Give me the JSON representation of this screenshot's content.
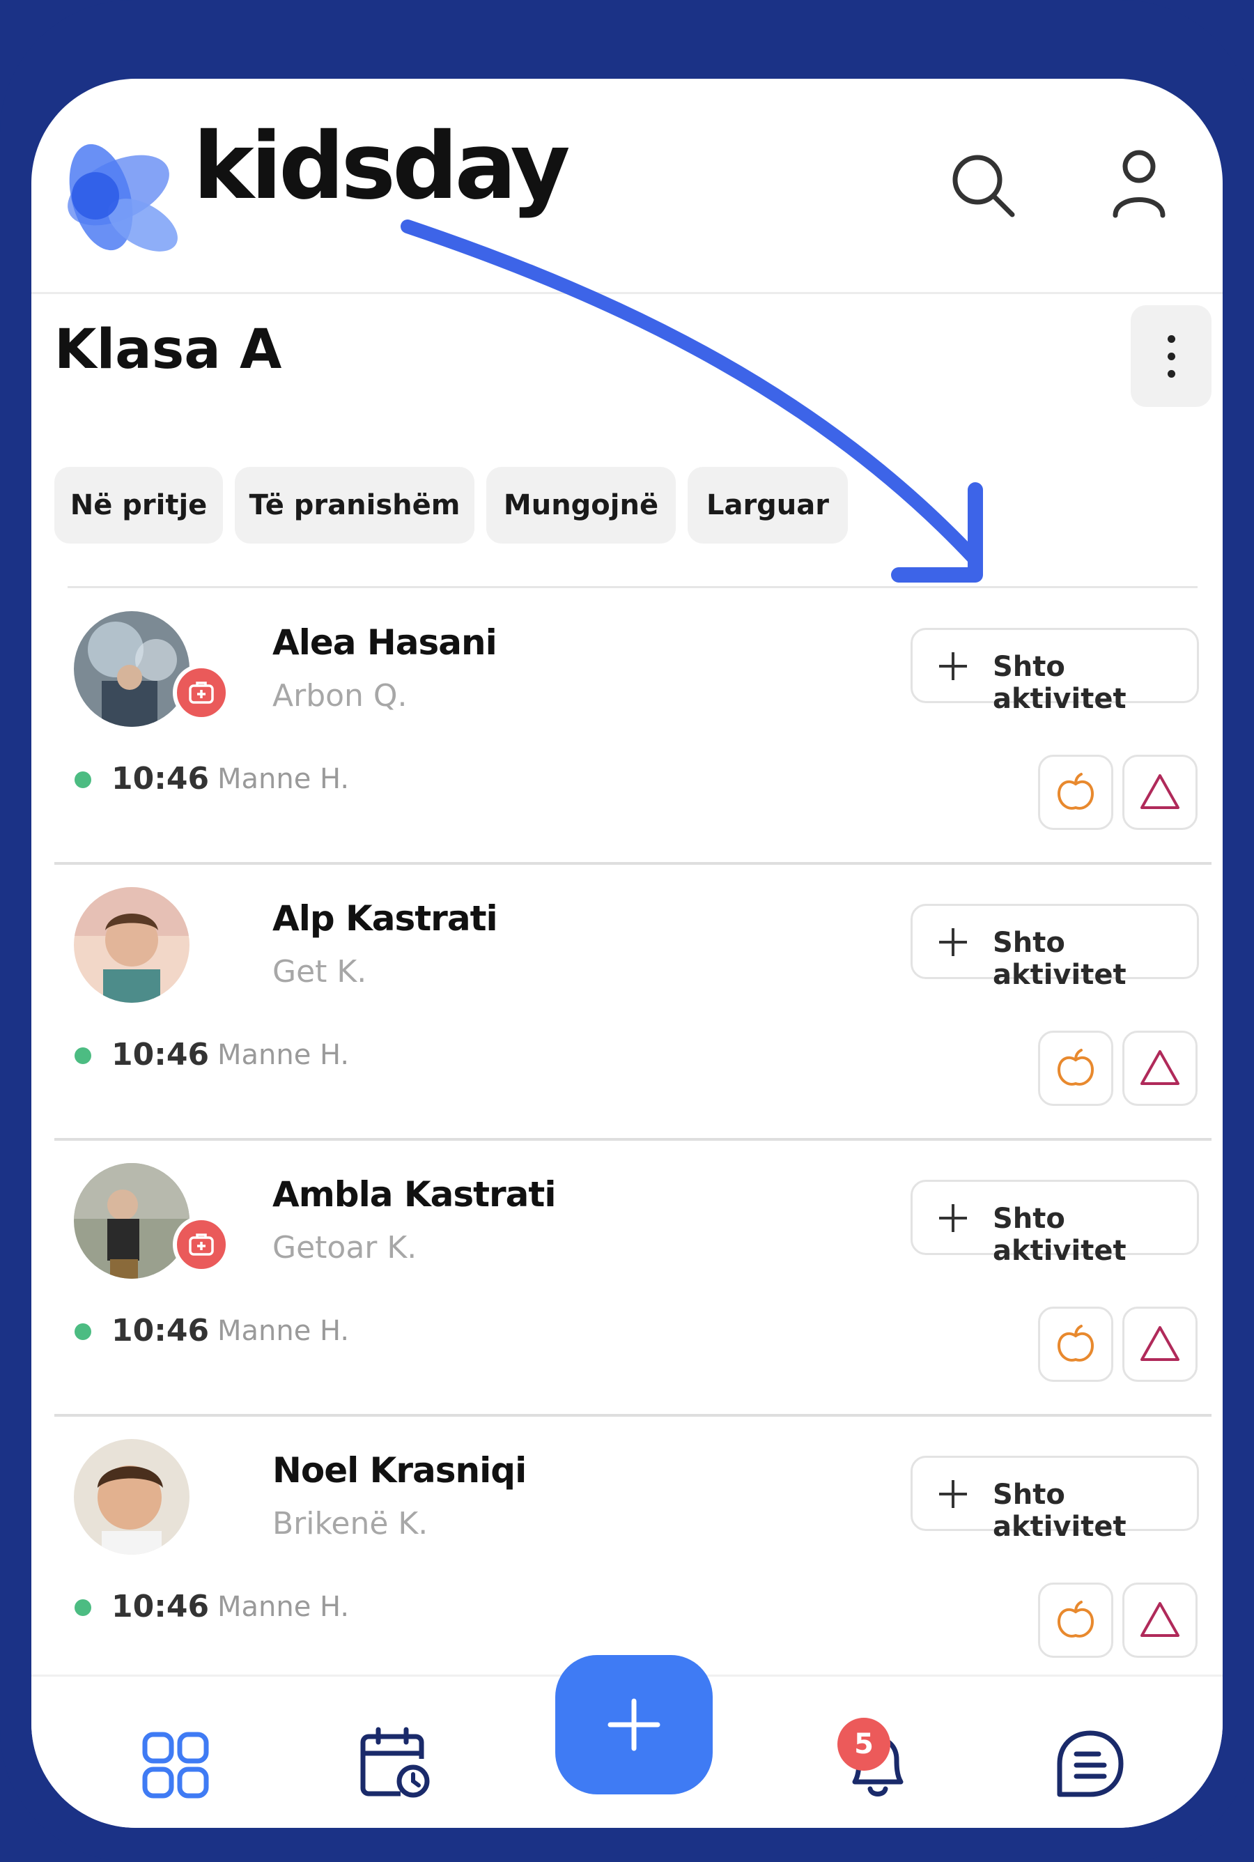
{
  "app": {
    "brand": "kidsday",
    "colors": {
      "frame": "#1b3286",
      "accent": "#3f7bf4",
      "present": "#4cbc82",
      "medical": "#ea5a5a",
      "food": "#e8892e",
      "alert": "#b02a5a"
    }
  },
  "header": {
    "icons": [
      "search-icon",
      "profile-icon"
    ]
  },
  "page": {
    "title": "Klasa A",
    "more_icon": "more-vertical-icon"
  },
  "filters": [
    {
      "label": "Në pritje"
    },
    {
      "label": "Të pranishëm"
    },
    {
      "label": "Mungojnë"
    },
    {
      "label": "Larguar"
    }
  ],
  "children": [
    {
      "name": "Alea Hasani",
      "parent": "Arbon Q.",
      "add_label": "Shto aktivitet",
      "time": "10:46",
      "checked_by": "Manne H.",
      "medical": true
    },
    {
      "name": "Alp Kastrati",
      "parent": "Get K.",
      "add_label": "Shto aktivitet",
      "time": "10:46",
      "checked_by": "Manne H.",
      "medical": false
    },
    {
      "name": "Ambla Kastrati",
      "parent": "Getoar K.",
      "add_label": "Shto aktivitet",
      "time": "10:46",
      "checked_by": "Manne H.",
      "medical": true
    },
    {
      "name": "Noel Krasniqi",
      "parent": "Brikenë K.",
      "add_label": "Shto aktivitet",
      "time": "10:46",
      "checked_by": "Manne H.",
      "medical": false
    }
  ],
  "bottom_nav": {
    "items": [
      "dashboard-grid-icon",
      "calendar-clock-icon",
      "add-icon",
      "bell-icon",
      "messages-icon"
    ],
    "notifications_count": "5"
  }
}
